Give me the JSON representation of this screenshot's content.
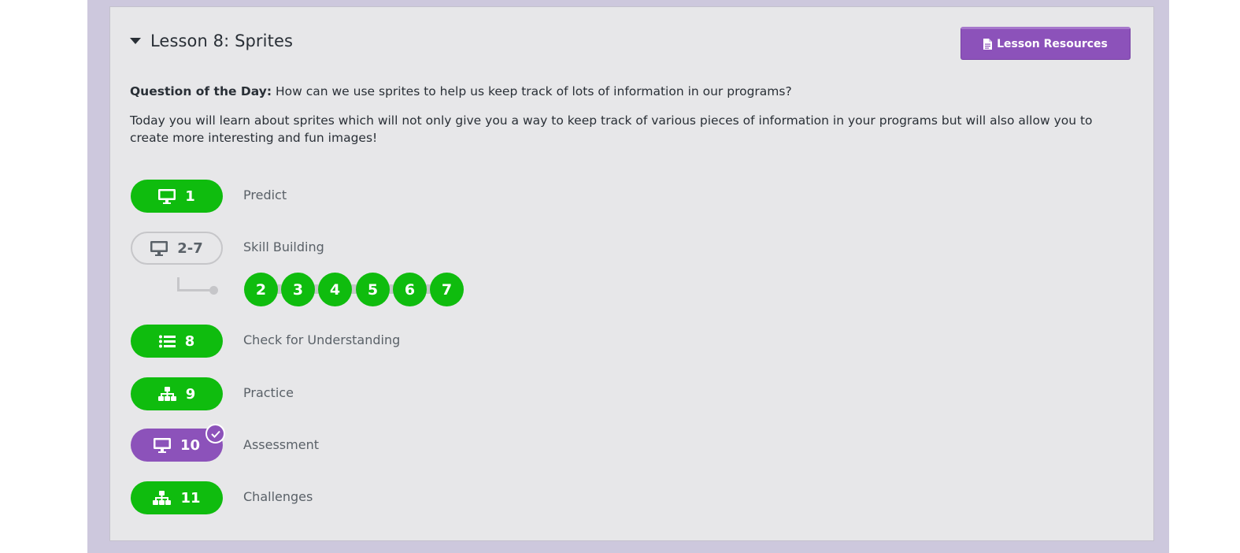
{
  "lesson": {
    "title": "Lesson 8: Sprites",
    "resources_label": "Lesson Resources",
    "qotd_label": "Question of the Day:",
    "qotd_text": " How can we use sprites to help us keep track of lots of information in our programs?",
    "description": "Today you will learn about sprites which will not only give you a way to keep track of various pieces of information in your programs but will also allow you to create more interesting and fun images!"
  },
  "levels": [
    {
      "number": "1",
      "label": "Predict",
      "icon": "desktop-icon",
      "status": "complete",
      "color": "#0fbc0e"
    },
    {
      "number": "2-7",
      "label": "Skill Building",
      "icon": "desktop-icon",
      "status": "group",
      "color": "#c6c6c9"
    },
    {
      "number": "8",
      "label": "Check for Understanding",
      "icon": "list-icon",
      "status": "complete",
      "color": "#0fbc0e"
    },
    {
      "number": "9",
      "label": "Practice",
      "icon": "sitemap-icon",
      "status": "complete",
      "color": "#0fbc0e"
    },
    {
      "number": "10",
      "label": "Assessment",
      "icon": "desktop-icon",
      "status": "submitted",
      "color": "#8c52ba"
    },
    {
      "number": "11",
      "label": "Challenges",
      "icon": "sitemap-icon",
      "status": "complete",
      "color": "#0fbc0e"
    }
  ],
  "sublevels": [
    "2",
    "3",
    "4",
    "5",
    "6",
    "7"
  ],
  "colors": {
    "complete": "#0fbc0e",
    "assessment": "#8c52ba",
    "background": "#cdc8dd",
    "card": "#e7e7e9"
  }
}
